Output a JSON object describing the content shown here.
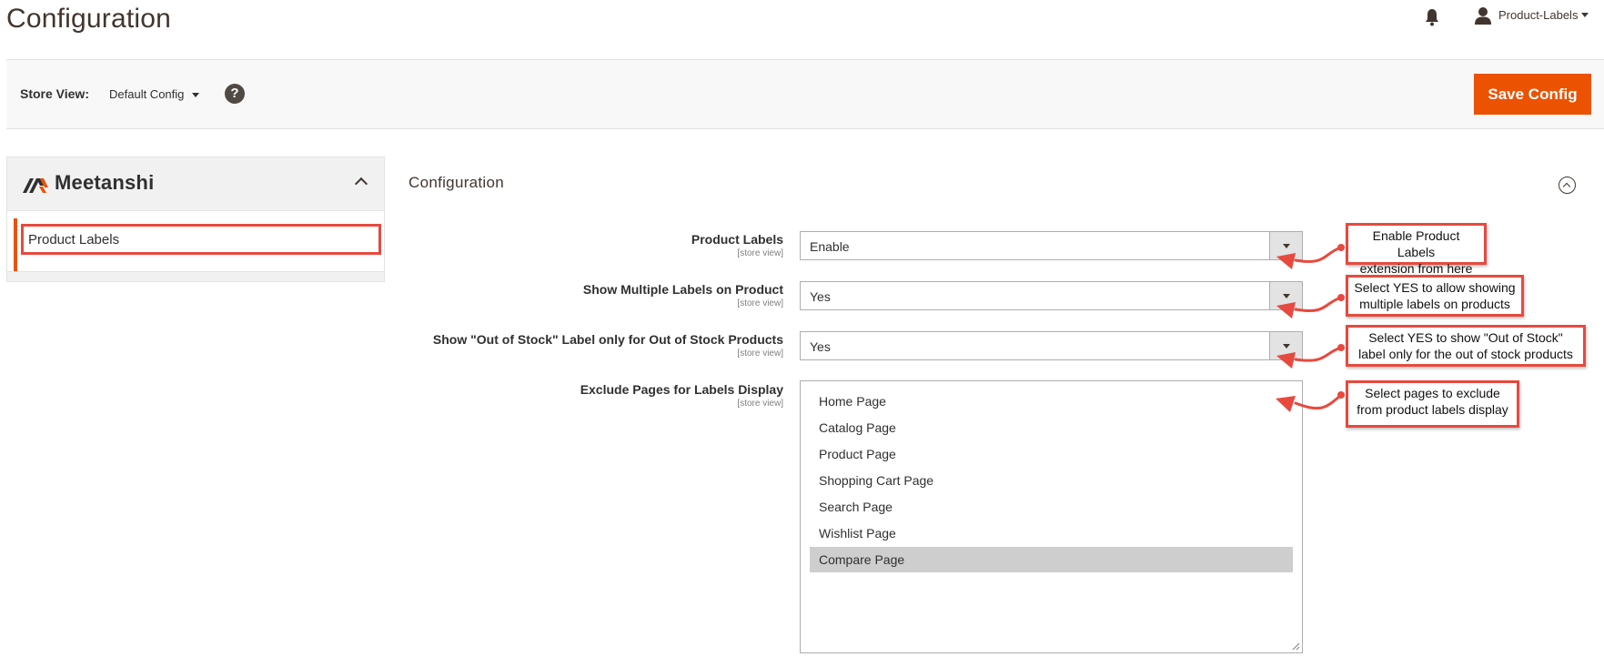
{
  "header": {
    "page_title": "Configuration",
    "user_name": "Product-Labels"
  },
  "store_bar": {
    "label": "Store View:",
    "value": "Default Config",
    "help": "?",
    "save_label": "Save Config"
  },
  "sidebar": {
    "brand": "Meetanshi",
    "items": [
      {
        "label": "Product Labels",
        "active": true
      }
    ]
  },
  "section": {
    "title": "Configuration"
  },
  "fields": [
    {
      "label": "Product Labels",
      "scope": "[store view]",
      "value": "Enable"
    },
    {
      "label": "Show Multiple Labels on Product",
      "scope": "[store view]",
      "value": "Yes"
    },
    {
      "label": "Show \"Out of Stock\" Label only for Out of Stock Products",
      "scope": "[store view]",
      "value": "Yes"
    },
    {
      "label": "Exclude Pages for Labels Display",
      "scope": "[store view]"
    }
  ],
  "exclude_pages": {
    "options": [
      "Home Page",
      "Catalog Page",
      "Product Page",
      "Shopping Cart Page",
      "Search Page",
      "Wishlist Page",
      "Compare Page"
    ],
    "selected": [
      "Compare Page"
    ]
  },
  "callouts": [
    {
      "line1": "Enable Product Labels",
      "line2": "extension from here"
    },
    {
      "line1": "Select YES to allow showing",
      "line2": "multiple labels on products"
    },
    {
      "line1": "Select YES to show \"Out of Stock\"",
      "line2": "label only for the out of stock products"
    },
    {
      "line1": "Select pages to exclude",
      "line2": "from product labels display"
    }
  ],
  "colors": {
    "accent": "#eb5202",
    "annotation": "#e8493e",
    "text": "#303030"
  },
  "icons": [
    "bell-icon",
    "user-icon",
    "help-icon",
    "meetanshi-logo-icon",
    "chevron-up-icon",
    "collapse-circle-icon",
    "dropdown-arrow-icon"
  ]
}
